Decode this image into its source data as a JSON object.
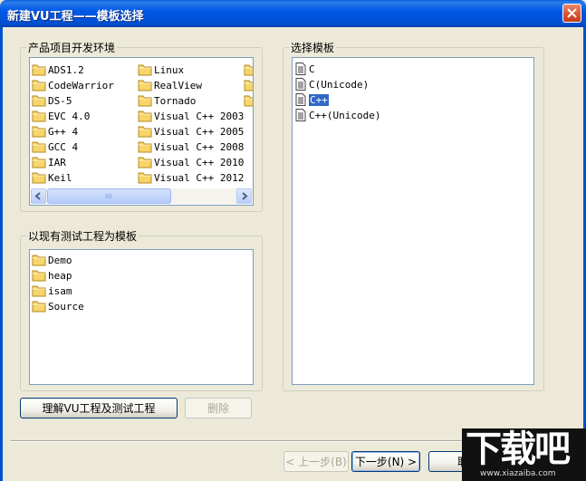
{
  "window": {
    "title": "新建VU工程——模板选择"
  },
  "env_group": {
    "label": "产品项目开发环境",
    "col1": [
      "ADS1.2",
      "CodeWarrior",
      "DS-5",
      "EVC 4.0",
      "G++ 4",
      "GCC 4",
      "IAR",
      "Keil"
    ],
    "col2": [
      "Linux",
      "RealView",
      "Tornado",
      "Visual C++ 2003",
      "Visual C++ 2005",
      "Visual C++ 2008",
      "Visual C++ 2010",
      "Visual C++ 2012"
    ]
  },
  "existing_group": {
    "label": "以现有测试工程为模板",
    "items": [
      "Demo",
      "heap",
      "isam",
      "Source"
    ]
  },
  "template_group": {
    "label": "选择模板",
    "items": [
      "C",
      "C(Unicode)",
      "C++",
      "C++(Unicode)"
    ],
    "selected": "C++"
  },
  "buttons": {
    "understand": "理解VU工程及测试工程",
    "delete": "删除",
    "prev": "< 上一步(B)",
    "next": "下一步(N) >",
    "cancel": "取"
  },
  "watermark": {
    "big": "下载吧",
    "small": "www.xiazaiba.com"
  },
  "colors": {
    "titlebar": "#0058e6",
    "selection": "#316ac5",
    "dialog_bg": "#ece9d8"
  }
}
